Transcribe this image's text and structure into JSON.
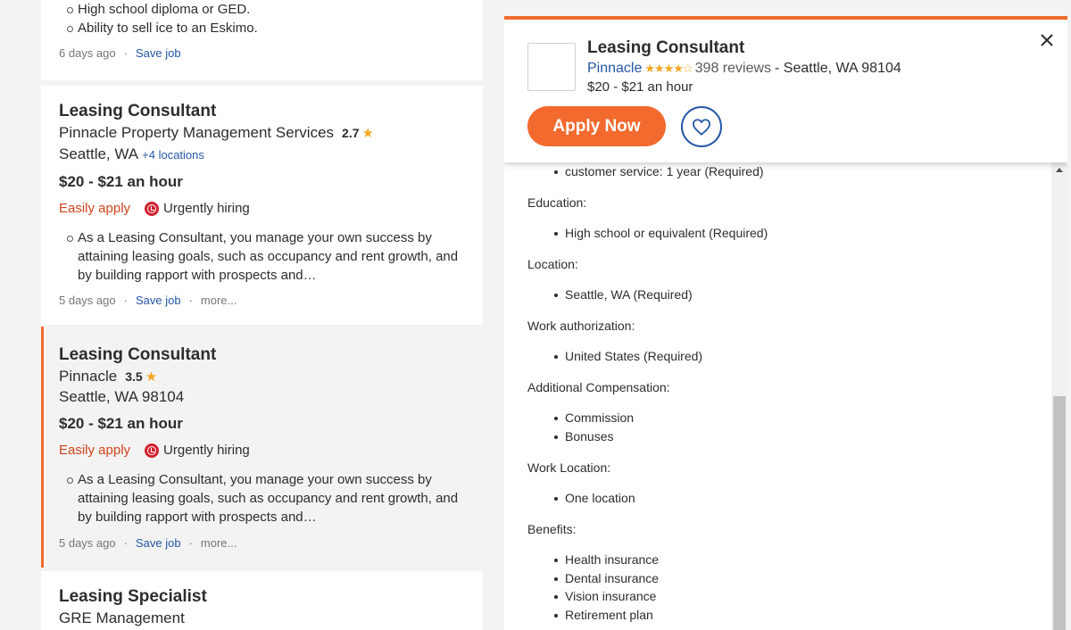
{
  "list": {
    "card0": {
      "bullets": [
        "High school diploma or GED.",
        "Ability to sell ice to an Eskimo."
      ],
      "posted": "6 days ago",
      "save": "Save job"
    },
    "card1": {
      "title": "Leasing Consultant",
      "company": "Pinnacle Property Management Services",
      "rating": "2.7",
      "location": "Seattle, WA",
      "more_locations": "+4 locations",
      "salary": "$20 - $21 an hour",
      "easy_apply": "Easily apply",
      "urgent": "Urgently hiring",
      "snippet": "As a Leasing Consultant, you manage your own success by attaining leasing goals, such as occupancy and rent growth, and by building rapport with prospects and…",
      "posted": "5 days ago",
      "save": "Save job",
      "more": "more..."
    },
    "card2": {
      "title": "Leasing Consultant",
      "company": "Pinnacle",
      "rating": "3.5",
      "location": "Seattle, WA 98104",
      "salary": "$20 - $21 an hour",
      "easy_apply": "Easily apply",
      "urgent": "Urgently hiring",
      "snippet": "As a Leasing Consultant, you manage your own success by attaining leasing goals, such as occupancy and rent growth, and by building rapport with prospects and…",
      "posted": "5 days ago",
      "save": "Save job",
      "more": "more..."
    },
    "card3": {
      "title": "Leasing Specialist",
      "company": "GRE Management"
    }
  },
  "detail": {
    "title": "Leasing Consultant",
    "company": "Pinnacle",
    "stars_rating": 3.5,
    "reviews": "398 reviews",
    "location": "- Seattle, WA 98104",
    "salary": "$20 - $21 an hour",
    "apply": "Apply Now",
    "experience_item": "customer service: 1 year (Required)",
    "education_label": "Education:",
    "education_item": "High school or equivalent (Required)",
    "location_label": "Location:",
    "location_item": "Seattle, WA (Required)",
    "work_auth_label": "Work authorization:",
    "work_auth_item": "United States (Required)",
    "comp_label": "Additional Compensation:",
    "comp_items": [
      "Commission",
      "Bonuses"
    ],
    "work_location_label": "Work Location:",
    "work_location_item": "One location",
    "benefits_label": "Benefits:",
    "benefits_items": [
      "Health insurance",
      "Dental insurance",
      "Vision insurance",
      "Retirement plan"
    ]
  },
  "colors": {
    "accent": "#f26a2e",
    "link": "#2557a7",
    "urgent": "#d0212f",
    "star": "#f5a623"
  }
}
